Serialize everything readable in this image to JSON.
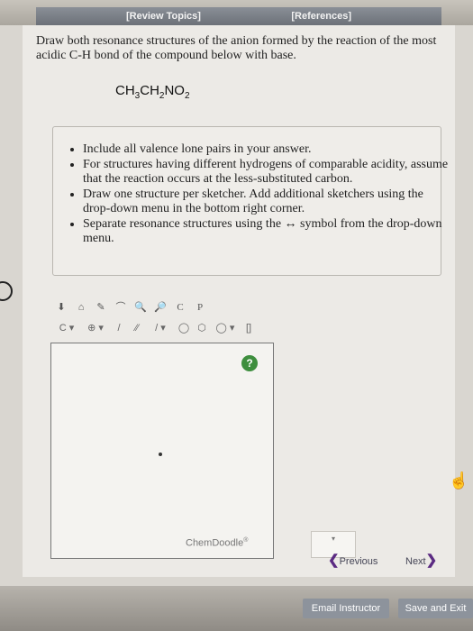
{
  "header": {
    "review_topics": "[Review Topics]",
    "references": "[References]"
  },
  "question": {
    "text": "Draw both resonance structures of the anion formed by the reaction of the most acidic C-H bond of the compound below with base.",
    "formula_parts": [
      "CH",
      "3",
      "CH",
      "2",
      "NO",
      "2"
    ]
  },
  "instructions": [
    "Include all valence lone pairs in your answer.",
    "For structures having different hydrogens of comparable acidity, assume that the reaction occurs at the less-substituted carbon.",
    "Draw one structure per sketcher. Add additional sketchers using the drop-down menu in the bottom right corner.",
    "Separate resonance structures using the ↔ symbol from the drop-down menu."
  ],
  "sketcher": {
    "brand": "ChemDoodle",
    "brand_mark": "®",
    "help_label": "?",
    "toolbar_row1": [
      "⬇",
      "⌂",
      "✎",
      "⌒",
      "🔍",
      "🔎",
      "C",
      "P"
    ],
    "toolbar_row2": [
      "C ▾",
      "⊕ ▾",
      "/",
      "⁄⁄",
      "/ ▾",
      "◯",
      "⬡",
      "◯ ▾",
      "[]"
    ]
  },
  "navigation": {
    "dropdown_label": "▾",
    "previous": "Previous",
    "next": "Next"
  },
  "footer": {
    "email_instructor": "Email Instructor",
    "save_and_exit": "Save and Exit"
  },
  "colors": {
    "nav_arrow": "#5b2a82",
    "help_green": "#3e8e3e"
  }
}
